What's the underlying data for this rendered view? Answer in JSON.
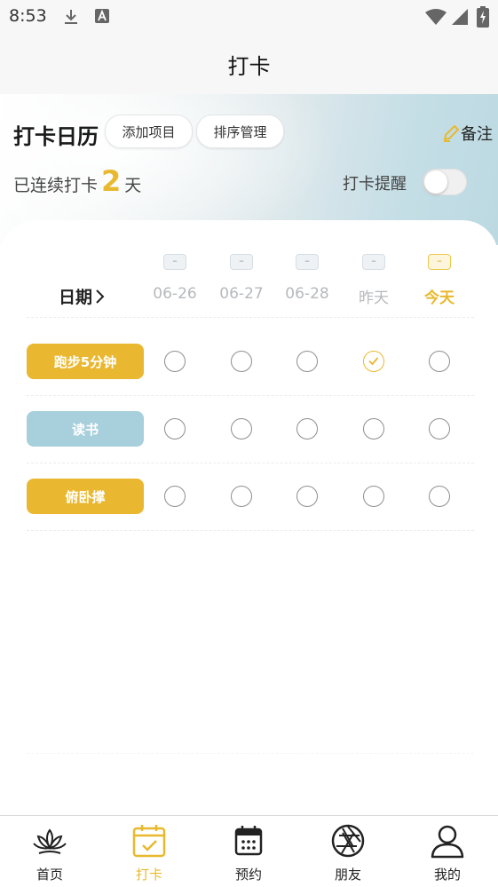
{
  "status_bar": {
    "time": "8:53"
  },
  "page": {
    "title": "打卡"
  },
  "header": {
    "calendar_title": "打卡日历",
    "add_item_label": "添加项目",
    "sort_label": "排序管理",
    "note_label": "备注",
    "streak_prefix": "已连续打卡",
    "streak_days": "2",
    "streak_suffix": "天",
    "reminder_label": "打卡提醒",
    "reminder_on": false
  },
  "calendar": {
    "date_header": "日期",
    "days": [
      {
        "badge": "–",
        "label": "06-26",
        "today": false
      },
      {
        "badge": "–",
        "label": "06-27",
        "today": false
      },
      {
        "badge": "–",
        "label": "06-28",
        "today": false
      },
      {
        "badge": "–",
        "label": "昨天",
        "today": false
      },
      {
        "badge": "–",
        "label": "今天",
        "today": true
      }
    ],
    "habits": [
      {
        "name": "跑步5分钟",
        "color": "#e9b830",
        "checks": [
          false,
          false,
          false,
          true,
          false
        ]
      },
      {
        "name": "读书",
        "color": "#a8cfdc",
        "checks": [
          false,
          false,
          false,
          false,
          false
        ]
      },
      {
        "name": "俯卧撑",
        "color": "#e9b830",
        "checks": [
          false,
          false,
          false,
          false,
          false
        ]
      }
    ]
  },
  "tabbar": {
    "tabs": [
      {
        "label": "首页",
        "icon": "lotus-icon",
        "active": false
      },
      {
        "label": "打卡",
        "icon": "calendar-check-icon",
        "active": true
      },
      {
        "label": "预约",
        "icon": "calendar-icon",
        "active": false
      },
      {
        "label": "朋友",
        "icon": "aperture-icon",
        "active": false
      },
      {
        "label": "我的",
        "icon": "person-icon",
        "active": false
      }
    ]
  },
  "colors": {
    "accent": "#e8b92e",
    "secondary": "#a8cfdc"
  }
}
